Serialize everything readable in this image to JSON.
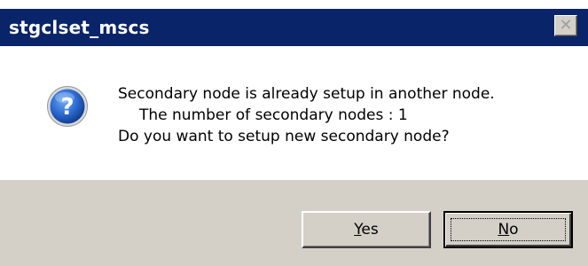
{
  "window": {
    "title": "stgclset_mscs",
    "close_glyph": "✕",
    "title_bar_color": "#0a246a"
  },
  "message": {
    "icon": "question-icon",
    "line1": "Secondary node is already setup in another node.",
    "line2": "The number of secondary nodes : 1",
    "line3": "Do you want to setup new secondary node?"
  },
  "buttons": {
    "yes": {
      "mnemonic": "Y",
      "rest": "es"
    },
    "no": {
      "mnemonic": "N",
      "rest": "o"
    }
  }
}
